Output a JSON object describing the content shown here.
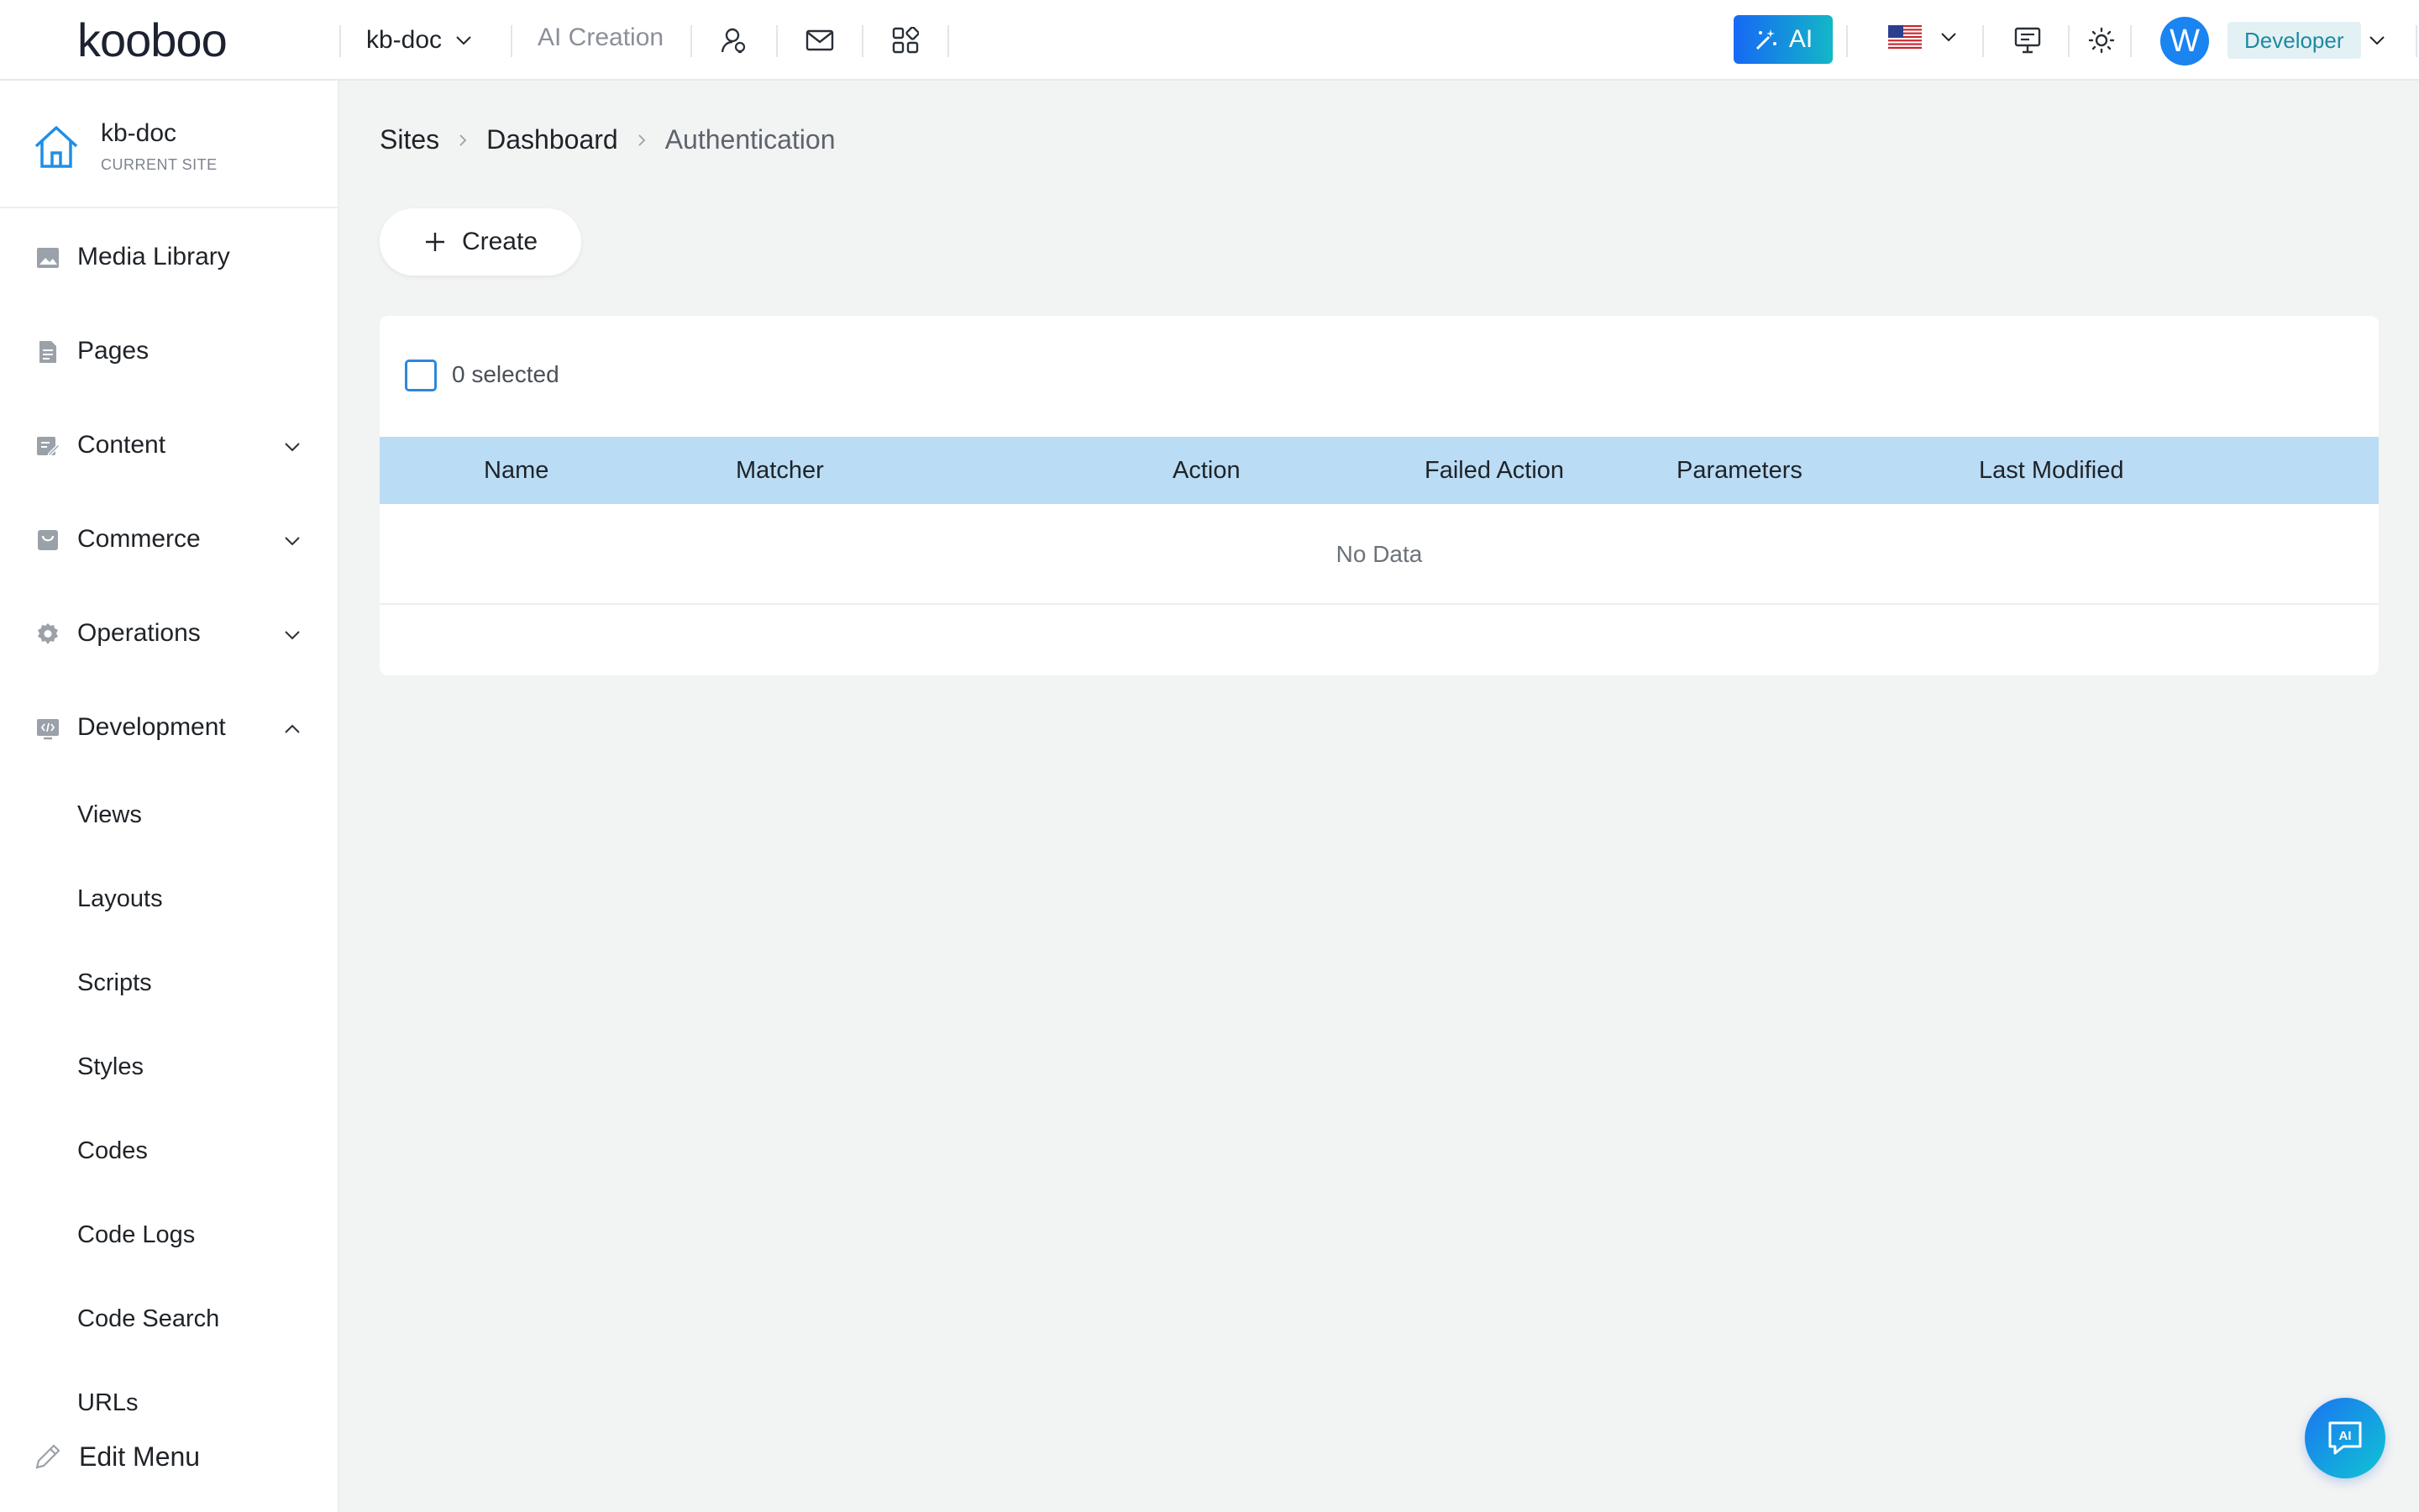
{
  "topbar": {
    "logo_text": "kooboo",
    "site_name": "kb-doc",
    "ai_creation": "AI Creation",
    "ai_button": "AI",
    "avatar_letter": "W",
    "role": "Developer",
    "accent": "#1668f5"
  },
  "sidebar": {
    "current_site": {
      "name": "kb-doc",
      "subtitle": "CURRENT SITE"
    },
    "items": [
      {
        "label": "Media Library",
        "icon": "image-icon"
      },
      {
        "label": "Pages",
        "icon": "document-icon"
      },
      {
        "label": "Content",
        "icon": "edit-note-icon"
      },
      {
        "label": "Commerce",
        "icon": "bag-icon"
      },
      {
        "label": "Operations",
        "icon": "gear-icon"
      },
      {
        "label": "Development",
        "icon": "code-window-icon"
      }
    ],
    "development_children": [
      "Views",
      "Layouts",
      "Scripts",
      "Styles",
      "Codes",
      "Code Logs",
      "Code Search",
      "URLs"
    ],
    "edit_menu": "Edit Menu"
  },
  "breadcrumb": [
    "Sites",
    "Dashboard",
    "Authentication"
  ],
  "toolbar": {
    "create_label": "Create"
  },
  "table": {
    "selected_text": "0 selected",
    "columns": [
      "Name",
      "Matcher",
      "Action",
      "Failed Action",
      "Parameters",
      "Last Modified"
    ],
    "empty_text": "No Data",
    "header_color": "#badcf5"
  },
  "chat_fab": {
    "label": "AI"
  }
}
